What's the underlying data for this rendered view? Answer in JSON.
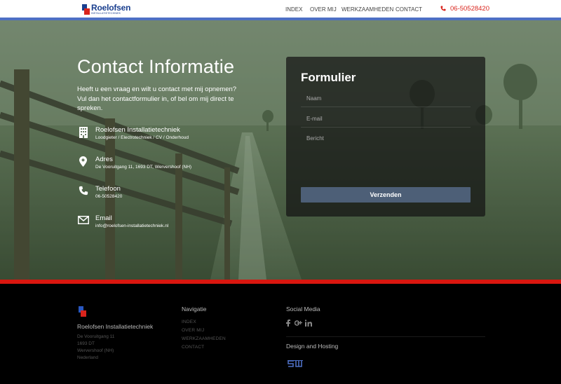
{
  "header": {
    "logo_name": "Roelofsen",
    "logo_sub": "INSTALLATIETECHNIEK",
    "nav": [
      {
        "label": "INDEX"
      },
      {
        "label": "OVER MIJ"
      },
      {
        "label": "WERKZAAMHEDEN"
      },
      {
        "label": "CONTACT"
      }
    ],
    "phone": "06-50528420"
  },
  "hero": {
    "title": "Contact Informatie",
    "intro": "Heeft u een vraag en wilt u contact met mij opnemen? Vul dan het contactformulier in, of bel om mij direct te spreken.",
    "items": [
      {
        "icon": "building-icon",
        "title": "Roelofsen Installatietechniek",
        "sub": "Loodgieter / Electrotechniek / CV / Onderhoud"
      },
      {
        "icon": "map-pin-icon",
        "title": "Adres",
        "sub": "De Vooruitgang 11, 1693 DT, Wervershoof (NH)"
      },
      {
        "icon": "phone-icon",
        "title": "Telefoon",
        "sub": "06-50528420"
      },
      {
        "icon": "envelope-icon",
        "title": "Email",
        "sub": "info@roelofsen-installatietechniek.nl"
      }
    ]
  },
  "form": {
    "title": "Formulier",
    "name_placeholder": "Naam",
    "email_placeholder": "E-mail",
    "message_placeholder": "Bericht",
    "submit_label": "Verzenden"
  },
  "footer": {
    "company": "Roelofsen Installatietechniek",
    "address": [
      "De Vooruitgang 11",
      "1693 DT",
      "Wervershoof (NH)",
      "Nederland"
    ],
    "nav_heading": "Navigatie",
    "nav_links": [
      "INDEX",
      "OVER MIJ",
      "WERKZAAMHEDEN",
      "CONTACT"
    ],
    "social_heading": "Social Media",
    "social_icons": [
      "facebook-icon",
      "google-plus-icon",
      "linkedin-icon"
    ],
    "hosting_heading": "Design and Hosting"
  },
  "colors": {
    "brand_blue": "#1a3f8f",
    "brand_red": "#d9241c",
    "accent_bar_blue": "#4d6fc4",
    "footer_bar_red": "#d9160f",
    "button": "#4d5f77"
  }
}
